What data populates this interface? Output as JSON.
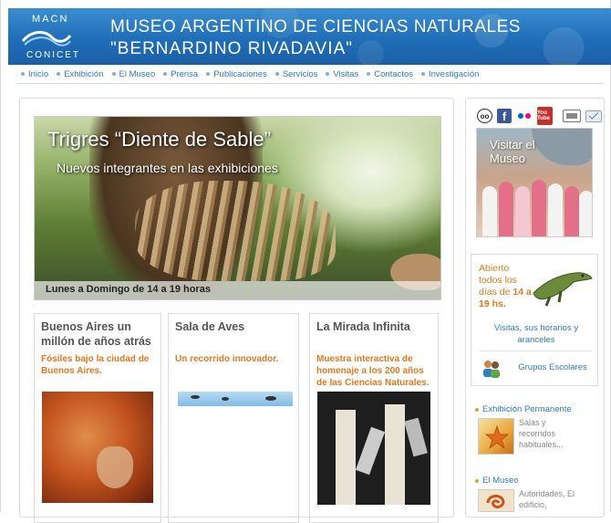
{
  "header": {
    "logo_top": "MACN",
    "logo_bottom": "CONICET",
    "title_line1": "MUSEO ARGENTINO DE CIENCIAS NATURALES",
    "title_line2": "\"BERNARDINO RIVADAVIA\"",
    "bg_color": "#1f6eb8"
  },
  "nav": {
    "items": [
      "Inicio",
      "Exhibición",
      "El Museo",
      "Prensa",
      "Publicaciones",
      "Servicios",
      "Visitas",
      "Contactos",
      "Investigación"
    ]
  },
  "hero": {
    "title": "Trigres “Diente de Sable”",
    "subtitle": "Nuevos integrantes en las exhibiciones",
    "hours": "Lunes a Domingo de 14 a 19 horas"
  },
  "cards": [
    {
      "title": "Buenos Aires un millón de años atrás",
      "subtitle": "Fósiles bajo la ciudad de Buenos Aires."
    },
    {
      "title": "Sala de Aves",
      "subtitle": "Un recorrido innovador."
    },
    {
      "title": "La Mirada Infinita",
      "subtitle": "Muestra interactiva de homenaje a los 200 años de las Ciencias Naturales."
    }
  ],
  "sidebar": {
    "social_icons": [
      "tripadvisor-icon",
      "facebook-icon",
      "flickr-icon",
      "youtube-icon",
      "print-icon",
      "email-icon"
    ],
    "youtube_label": "You Tube",
    "visit_label": "Visitar el Museo",
    "open_line1": "Abierto todos los días de",
    "open_hours": "14 a 19 hs.",
    "visits_link": "Visitas, sus horarios y aranceles",
    "groups_link": "Grupos Escolares",
    "sections": [
      {
        "label": "Exhibición Permanente",
        "desc": "Salas y recorridos habituales..."
      },
      {
        "label": "El Museo",
        "desc": "Autoridades, El edificio,"
      }
    ]
  },
  "accent_orange": "#e07a1f",
  "link_blue": "#2f7dbf"
}
